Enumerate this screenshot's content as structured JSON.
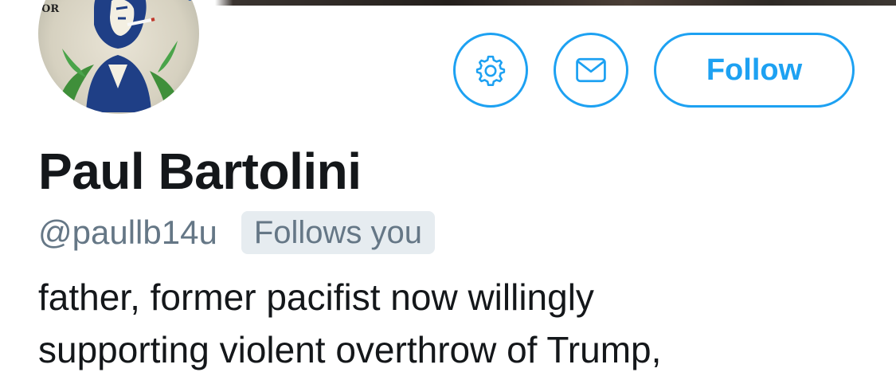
{
  "profile": {
    "display_name": "Paul Bartolini",
    "handle": "@paullb14u",
    "follows_you_label": "Follows you",
    "bio_lines": [
      "father, former pacifist now willingly",
      "supporting violent overthrow of Trump,"
    ]
  },
  "actions": {
    "settings_icon": "gear-icon",
    "message_icon": "envelope-icon",
    "follow_label": "Follow"
  },
  "colors": {
    "accent": "#1da1f2",
    "name_text": "#14171a",
    "secondary_text": "#657786",
    "badge_bg": "#e6ecf0"
  }
}
